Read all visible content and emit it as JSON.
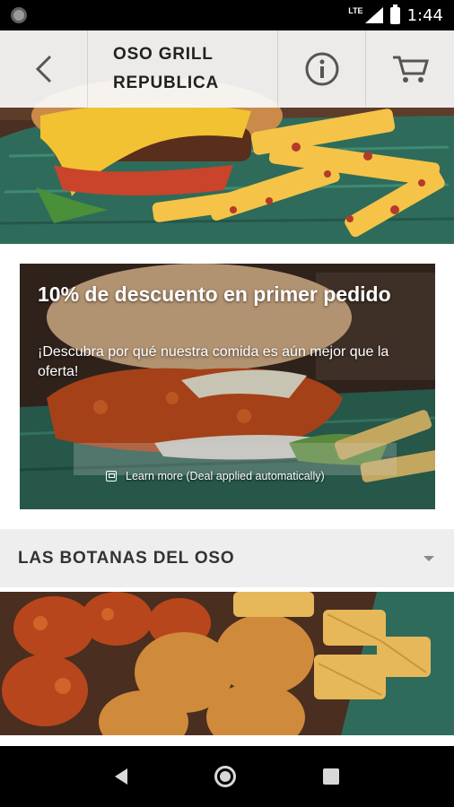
{
  "status_bar": {
    "network": "LTE",
    "time": "1:44"
  },
  "toolbar": {
    "title_line1": "OSO GRILL",
    "title_line2": "REPUBLICA",
    "icons": {
      "back": "back-arrow-icon",
      "info": "info-icon",
      "cart": "cart-icon"
    }
  },
  "promo": {
    "title": "10% de descuento en primer pedido",
    "subtitle": "¡Descubra por qué nuestra comida es aún mejor que la oferta!",
    "learn_more": "Learn more (Deal applied automatically)"
  },
  "section": {
    "title": "LAS BOTANAS DEL OSO"
  },
  "colors": {
    "toolbar_bg": "#fafafa",
    "section_bg": "#eeeeee",
    "basket_green": "#2f6b5a",
    "cheese": "#f2c94c"
  }
}
